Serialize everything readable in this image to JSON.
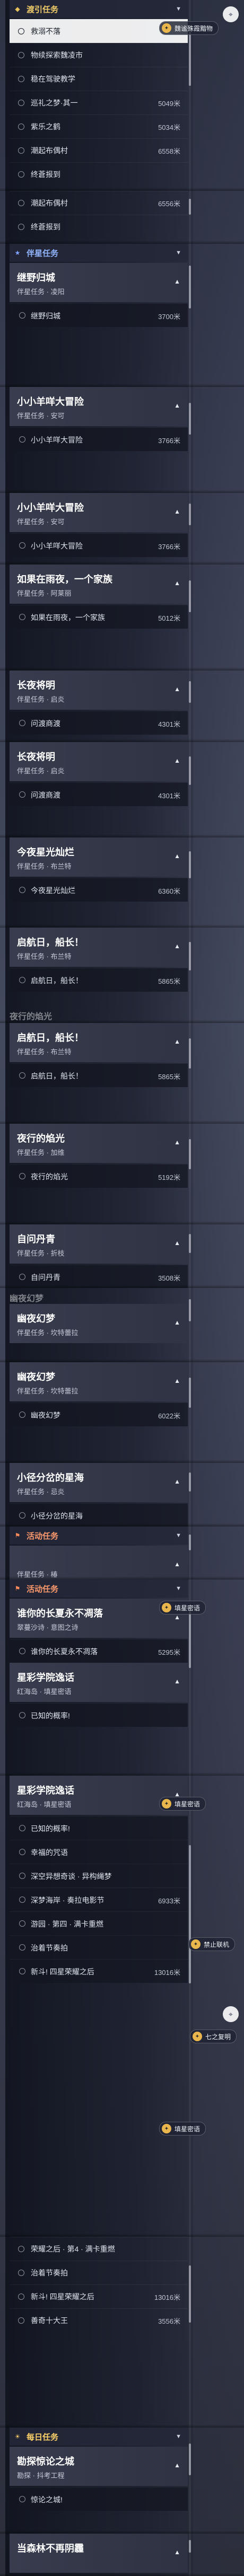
{
  "colors": {
    "main": "#f0cb6a",
    "side": "#92b4ff",
    "event": "#ff9a6e",
    "daily": "#ffd26a",
    "selected_bg": "#ffffff"
  },
  "icons": {
    "main": "diamond-icon",
    "side": "star-icon",
    "event": "flag-icon",
    "daily": "sun-icon",
    "expand": "chevron-up-icon",
    "collapse": "chevron-down-icon",
    "waypoint": "circle-icon",
    "map_pin": "map-pin-icon",
    "chip": "speech-icon"
  },
  "segments": {
    "s1": {
      "cat": "渡引任务",
      "items": [
        {
          "name": "救溺不落"
        },
        {
          "name": "物续探索魏凌市"
        },
        {
          "name": "稳在驾驶教学"
        },
        {
          "name": "巡礼之梦·其一",
          "dist": "5049米"
        },
        {
          "name": "紫乐之鹤",
          "dist": "5034米"
        },
        {
          "name": "潮起布偶村",
          "dist": "6558米"
        },
        {
          "name": "终蒼报到"
        }
      ],
      "chip": "魏谧殊霞黯物"
    },
    "s2": {
      "items": [
        {
          "name": "潮起布偶村",
          "dist": "6556米"
        },
        {
          "name": "终蒼报到"
        }
      ]
    },
    "s3": {
      "cat": "伴星任务",
      "quest": {
        "title": "继野归城",
        "sub": "伴星任务 · 凌阳"
      },
      "items": [
        {
          "name": "继野归城",
          "dist": "3700米"
        }
      ]
    },
    "s4": {
      "quest": {
        "title": "小小羊咩大冒险",
        "sub": "伴星任务 · 安可"
      },
      "items": [
        {
          "name": "小小羊咩大冒险",
          "dist": "3766米"
        }
      ]
    },
    "s5": {
      "quest": {
        "title": "小小羊咩大冒险",
        "sub": "伴星任务 · 安可"
      },
      "items": [
        {
          "name": "小小羊咩大冒险",
          "dist": "3766米"
        }
      ]
    },
    "s6": {
      "quest": {
        "title": "如果在雨夜，一个家族",
        "sub": "伴星任务 · 阿莱丽"
      },
      "items": [
        {
          "name": "如果在雨夜，一个家族",
          "dist": "5012米"
        }
      ]
    },
    "s7": {
      "quest": {
        "title": "长夜将明",
        "sub": "伴星任务 · 启炎"
      },
      "items": [
        {
          "name": "问渡商渡",
          "dist": "4301米"
        }
      ]
    },
    "s8": {
      "quest": {
        "title": "长夜将明",
        "sub": "伴星任务 · 启炎"
      },
      "items": [
        {
          "name": "问渡商渡",
          "dist": "4301米"
        }
      ]
    },
    "s9": {
      "quest": {
        "title": "今夜星光灿烂",
        "sub": "伴星任务 · 布兰特"
      },
      "items": [
        {
          "name": "今夜星光灿烂",
          "dist": "6360米"
        }
      ]
    },
    "s10": {
      "quest": {
        "title": "启航日，船长！",
        "sub": "伴星任务 · 布兰特"
      },
      "items": [
        {
          "name": "启航日，船长！",
          "dist": "5865米"
        }
      ],
      "ghost": "夜行的焰光"
    },
    "s11": {
      "quest": {
        "title": "启航日，船长！",
        "sub": "伴星任务 · 布兰特"
      },
      "items": [
        {
          "name": "启航日，船长！",
          "dist": "5865米"
        }
      ]
    },
    "s12": {
      "quest": {
        "title": "夜行的焰光",
        "sub": "伴星任务 · 加维"
      },
      "items": [
        {
          "name": "夜行的焰光",
          "dist": "5192米"
        }
      ]
    },
    "s13": {
      "quest": {
        "title": "自问丹青",
        "sub": "伴星任务 · 折枝"
      },
      "items": [
        {
          "name": "自问丹青",
          "dist": "3508米"
        }
      ]
    },
    "s14": {
      "quest": {
        "title": "幽夜幻梦",
        "sub": "伴星任务 · 坎特蕾拉"
      },
      "items": [
        {
          "name": "自问丹青",
          "dist": "3508米"
        }
      ],
      "top": "幽夜幻梦"
    },
    "s15": {
      "quest": {
        "title": "幽夜幻梦",
        "sub": "伴星任务 · 坎特蕾拉"
      },
      "items": [
        {
          "name": "幽夜幻梦",
          "dist": "6022米"
        }
      ]
    },
    "s16": {
      "quest": {
        "title": "小径分岔的星海",
        "sub": "伴星任务 · 忌炎"
      },
      "items": [
        {
          "name": "小径分岔的星海"
        }
      ]
    },
    "s17": {
      "cat": "活动任务",
      "quest": {
        "title": "",
        "sub": "伴星任务 · 椿"
      }
    },
    "s18": {
      "cat": "活动任务",
      "quest": {
        "title": "谁你的长夏永不凋落",
        "sub": "翠蔓沙诗 · 意图之诗"
      },
      "items": [
        {
          "name": "谁你的长夏永不凋落",
          "dist": "5295米"
        }
      ],
      "quest2": {
        "title": "星彩学院逸话",
        "sub": "红海岛 · 填星密语"
      },
      "items2": [
        {
          "name": "已知的概率!"
        }
      ],
      "chip": "填星密语"
    },
    "s19": {
      "quest": {
        "title": "星彩学院逸话",
        "sub": "红海岛 · 填星密语"
      },
      "items": [
        {
          "name": "已知的概率!"
        },
        {
          "name": "幸福的咒语"
        },
        {
          "name": "深空异想奇谈 · 异构绳梦"
        },
        {
          "name": "深梦海岸 · 奏拉电影节",
          "dist": "6933米"
        },
        {
          "name": "游园 · 第四 · 满卡重燃"
        },
        {
          "name": "治着节奏拍"
        },
        {
          "name": "新斗! 四星荣耀之后",
          "dist": "13016米"
        }
      ],
      "chip": "填星密语",
      "chip2": "禁止联机",
      "chip3": "七之复明",
      "chip4": "填星密语"
    },
    "s20": {
      "items": [
        {
          "name": "荣耀之后 · 第4 · 满卡重燃"
        },
        {
          "name": "治着节奏拍"
        },
        {
          "name": "新斗! 四星荣耀之后",
          "dist": "13016米"
        },
        {
          "name": "善奇十大王",
          "dist": "3556米"
        }
      ]
    },
    "s21": {
      "cat": "每日任务",
      "quest": {
        "title": "勘探惊论之城",
        "sub": "勘探 · 抖考工程"
      },
      "items": [
        {
          "name": "惊论之城!"
        }
      ]
    },
    "s22": {
      "quest": {
        "title": "当森林不再阴霾",
        "sub": ""
      }
    }
  }
}
